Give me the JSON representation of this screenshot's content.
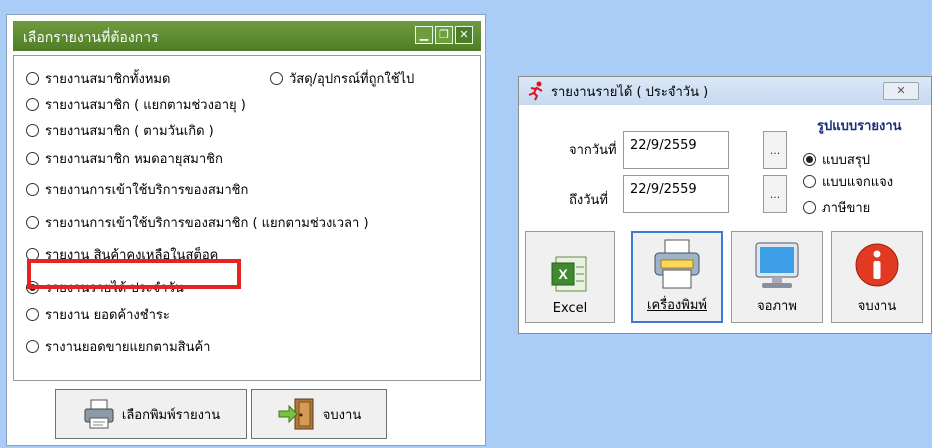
{
  "report_window": {
    "title": "เลือกรายงานที่ต้องการ",
    "options": [
      "รายงานสมาชิกทั้งหมด",
      "วัสดุ/อุปกรณ์ที่ถูกใช้ไป",
      "รายงานสมาชิก ( แยกตามช่วงอายุ )",
      "รายงานสมาชิก ( ตามวันเกิด )",
      "รายงานสมาชิก หมดอายุสมาชิก",
      "รายงานการเข้าใช้บริการของสมาชิก",
      "รายงานการเข้าใช้บริการของสมาชิก ( แยกตามช่วงเวลา )",
      "รายงาน สินค้าคงเหลือในสต็อค",
      "รายงานรายได้ ประจำวัน",
      "รายงาน ยอดค้างชำระ",
      "รางานยอดขายแยกตามสินค้า"
    ],
    "selected_option": "รายงานรายได้ ประจำวัน",
    "print_button": "เลือกพิมพ์รายงาน",
    "exit_button": "จบงาน"
  },
  "daily_income_window": {
    "title": "รายงานรายได้ ( ประจำวัน )",
    "from_label": "จากวันที่",
    "from_date": "22/9/2559",
    "to_label": "ถึงวันที่",
    "to_date": "22/9/2559",
    "browse": "...",
    "format_title": "รูปแบบรายงาน",
    "formats": [
      "แบบสรุป",
      "แบบแจกแจง",
      "ภาษีขาย"
    ],
    "selected_format": "แบบสรุป",
    "buttons": [
      "Excel",
      "เครื่องพิมพ์",
      "จอภาพ",
      "จบงาน"
    ],
    "close_glyph": "✕"
  },
  "colors": {
    "title_green": "#5c8b31",
    "highlight_red": "#e52421",
    "desktop_blue": "#a9cdf6"
  }
}
